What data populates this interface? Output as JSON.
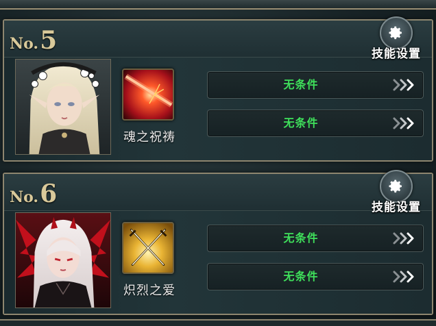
{
  "entries": [
    {
      "no_prefix": "No.",
      "number": "5",
      "settings_label": "技能设置",
      "settings_icon": "gear-icon",
      "skill_name": "魂之祝祷",
      "conditions": [
        "无条件",
        "无条件"
      ]
    },
    {
      "no_prefix": "No.",
      "number": "6",
      "settings_label": "技能设置",
      "settings_icon": "gear-icon",
      "skill_name": "炽烈之爱",
      "conditions": [
        "无条件",
        "无条件"
      ]
    }
  ],
  "colors": {
    "condition_text": "#3fe05b",
    "gold": "#d9c99a",
    "frame": "#8e866f"
  }
}
